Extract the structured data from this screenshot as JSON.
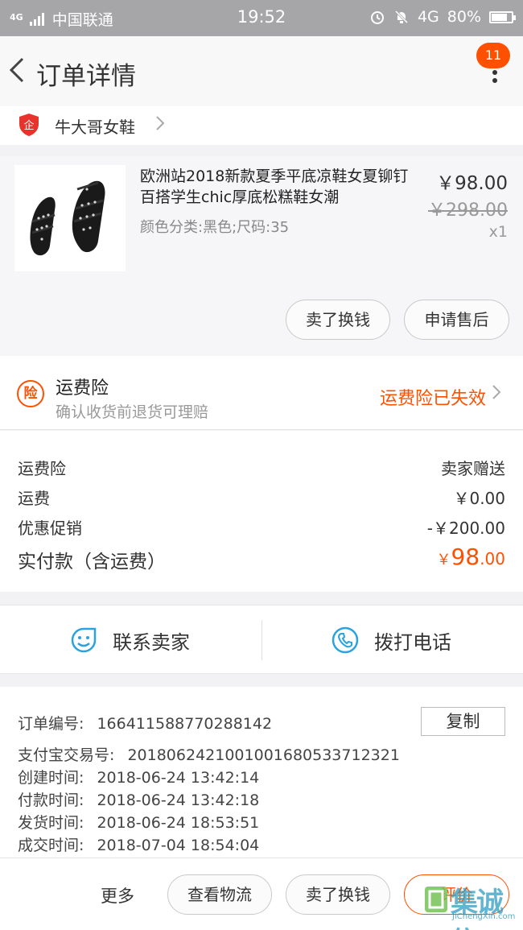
{
  "status_bar": {
    "signal": "4G",
    "carrier": "中国联通",
    "time": "19:52",
    "network": "4G",
    "battery": "80%",
    "battery_level": 0.8
  },
  "nav": {
    "title": "订单详情",
    "badge": "11"
  },
  "shop": {
    "logo_text": "企",
    "name": "牛大哥女鞋"
  },
  "item": {
    "name": "欧洲站2018新款夏季平底凉鞋女夏铆钉百搭学生chic厚底松糕鞋女潮",
    "sku": "颜色分类:黑色;尺码:35",
    "price": "￥98.00",
    "original_price": "￥298.00",
    "quantity": "x1",
    "actions": [
      "卖了换钱",
      "申请售后"
    ]
  },
  "insurance": {
    "icon_text": "险",
    "title": "运费险",
    "subtitle": "确认收货前退货可理赔",
    "status": "运费险已失效"
  },
  "fees": [
    {
      "label": "运费险",
      "value": "卖家赠送"
    },
    {
      "label": "运费",
      "value": "￥0.00"
    },
    {
      "label": "优惠促销",
      "value": "-￥200.00"
    }
  ],
  "total": {
    "label": "实付款（含运费）",
    "currency": "￥",
    "integer": "98",
    "decimal": ".00"
  },
  "contact": {
    "seller_label": "联系卖家",
    "phone_label": "拨打电话"
  },
  "order_info": {
    "order_no_label": "订单编号:",
    "order_no": "166411588770288142",
    "copy_label": "复制",
    "alipay_label": "支付宝交易号:",
    "alipay_no": "2018062421001001680533712321",
    "created_label": "创建时间:",
    "created": "2018-06-24 13:42:14",
    "paid_label": "付款时间:",
    "paid": "2018-06-24 13:42:18",
    "shipped_label": "发货时间:",
    "shipped": "2018-06-24 18:53:51",
    "completed_label": "成交时间:",
    "completed": "2018-07-04 18:54:04"
  },
  "bottom": {
    "more_label": "更多",
    "logistics_label": "查看物流",
    "sell_label": "卖了换钱",
    "rate_label": "评价"
  },
  "watermark": {
    "text": "集诚信",
    "url": "JiChengXin.com"
  },
  "colors": {
    "accent": "#ff5000",
    "icon_blue": "#2aa3e0"
  }
}
